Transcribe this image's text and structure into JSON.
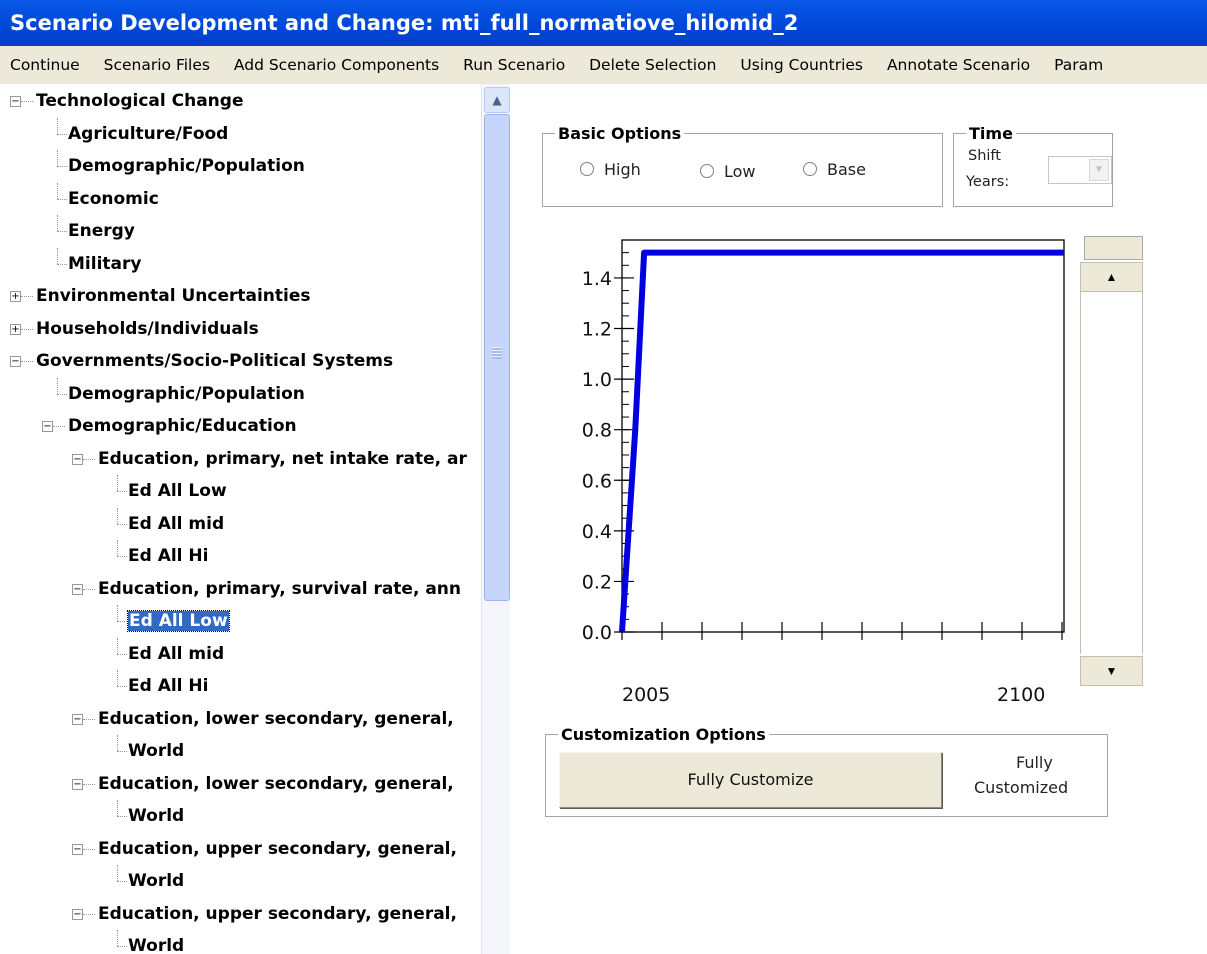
{
  "window": {
    "title": "Scenario Development and Change: mti_full_normatiove_hilomid_2"
  },
  "menu": {
    "items": [
      "Continue",
      "Scenario Files",
      "Add Scenario Components",
      "Run Scenario",
      "Delete Selection",
      "Using Countries",
      "Annotate Scenario",
      "Param"
    ]
  },
  "tree": {
    "nodes": [
      "Technological Change",
      "Agriculture/Food",
      "Demographic/Population",
      "Economic",
      "Energy",
      "Military",
      "Environmental Uncertainties",
      "Households/Individuals",
      "Governments/Socio-Political Systems",
      "Demographic/Population",
      "Demographic/Education",
      "Education, primary, net intake rate, ar",
      "Ed All Low",
      "Ed All mid",
      "Ed All Hi",
      "Education, primary, survival rate, ann",
      "Ed All Low",
      "Ed All mid",
      "Ed All Hi",
      "Education, lower secondary, general,",
      "World",
      "Education, lower secondary, general,",
      "World",
      "Education, upper secondary, general,",
      "World",
      "Education, upper secondary, general,",
      "World"
    ],
    "selected_index": 16
  },
  "basic_options": {
    "title": "Basic Options",
    "options": [
      "High",
      "Low",
      "Base"
    ]
  },
  "time": {
    "title": "Time",
    "shift_label_1": "Shift",
    "shift_label_2": "Years:",
    "combo_value": ""
  },
  "chart_data": {
    "type": "line",
    "x_tick_labels": [
      "2005",
      "2100"
    ],
    "y_ticks": [
      "0.0",
      "0.2",
      "0.4",
      "0.6",
      "0.8",
      "1.0",
      "1.2",
      "1.4"
    ],
    "ylim": [
      0,
      1.55
    ],
    "xlim": [
      2000,
      2100
    ],
    "series": [
      {
        "color": "#0000e0",
        "x": [
          2000,
          2003,
          2005,
          2100
        ],
        "y": [
          0,
          0.8,
          1.5,
          1.5
        ]
      }
    ],
    "grid": false
  },
  "customization": {
    "title": "Customization Options",
    "button_label": "Fully Customize",
    "status_line_1": "Fully",
    "status_line_2": "Customized"
  }
}
